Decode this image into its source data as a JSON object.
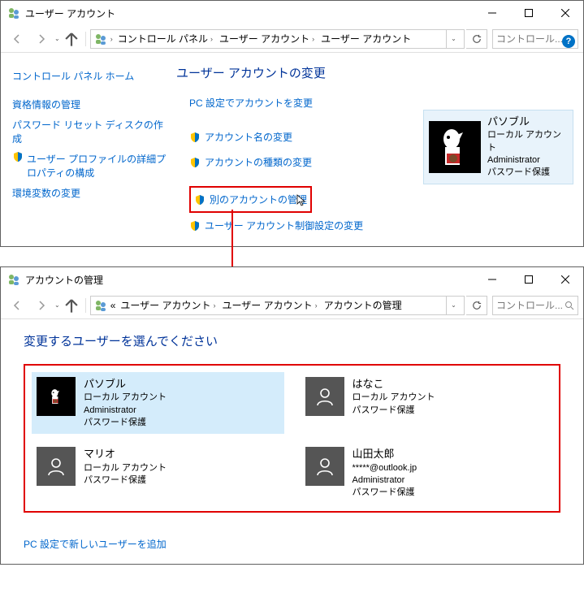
{
  "w1": {
    "title": "ユーザー アカウント",
    "crumbs": [
      "コントロール パネル",
      "ユーザー アカウント",
      "ユーザー アカウント"
    ],
    "searchPH": "コントロール...",
    "leftnav": {
      "home": "コントロール パネル ホーム",
      "cred": "資格情報の管理",
      "pwdisk": "パスワード リセット ディスクの作成",
      "profile": "ユーザー プロファイルの詳細プロパティの構成",
      "env": "環境変数の変更"
    },
    "main": {
      "heading": "ユーザー アカウントの変更",
      "pcset": "PC 設定でアカウントを変更",
      "rename": "アカウント名の変更",
      "acctype": "アカウントの種類の変更",
      "other": "別のアカウントの管理",
      "uac": "ユーザー アカウント制御設定の変更"
    },
    "card": {
      "name": "パソブル",
      "type": "ローカル アカウント",
      "role": "Administrator",
      "pw": "パスワード保護"
    }
  },
  "w2": {
    "title": "アカウントの管理",
    "crumbs": [
      "ユーザー アカウント",
      "ユーザー アカウント",
      "アカウントの管理"
    ],
    "crumbPrefix": "«",
    "searchPH": "コントロール...",
    "heading": "変更するユーザーを選んでください",
    "accounts": [
      {
        "name": "パソブル",
        "l2": "ローカル アカウント",
        "l3": "Administrator",
        "l4": "パスワード保護",
        "sel": true,
        "img": true
      },
      {
        "name": "はなこ",
        "l2": "ローカル アカウント",
        "l3": "パスワード保護",
        "l4": "",
        "sel": false,
        "img": false
      },
      {
        "name": "マリオ",
        "l2": "ローカル アカウント",
        "l3": "パスワード保護",
        "l4": "",
        "sel": false,
        "img": false
      },
      {
        "name": "山田太郎",
        "l2": "*****@outlook.jp",
        "l3": "Administrator",
        "l4": "パスワード保護",
        "sel": false,
        "img": false
      }
    ],
    "addnew": "PC 設定で新しいユーザーを追加"
  }
}
